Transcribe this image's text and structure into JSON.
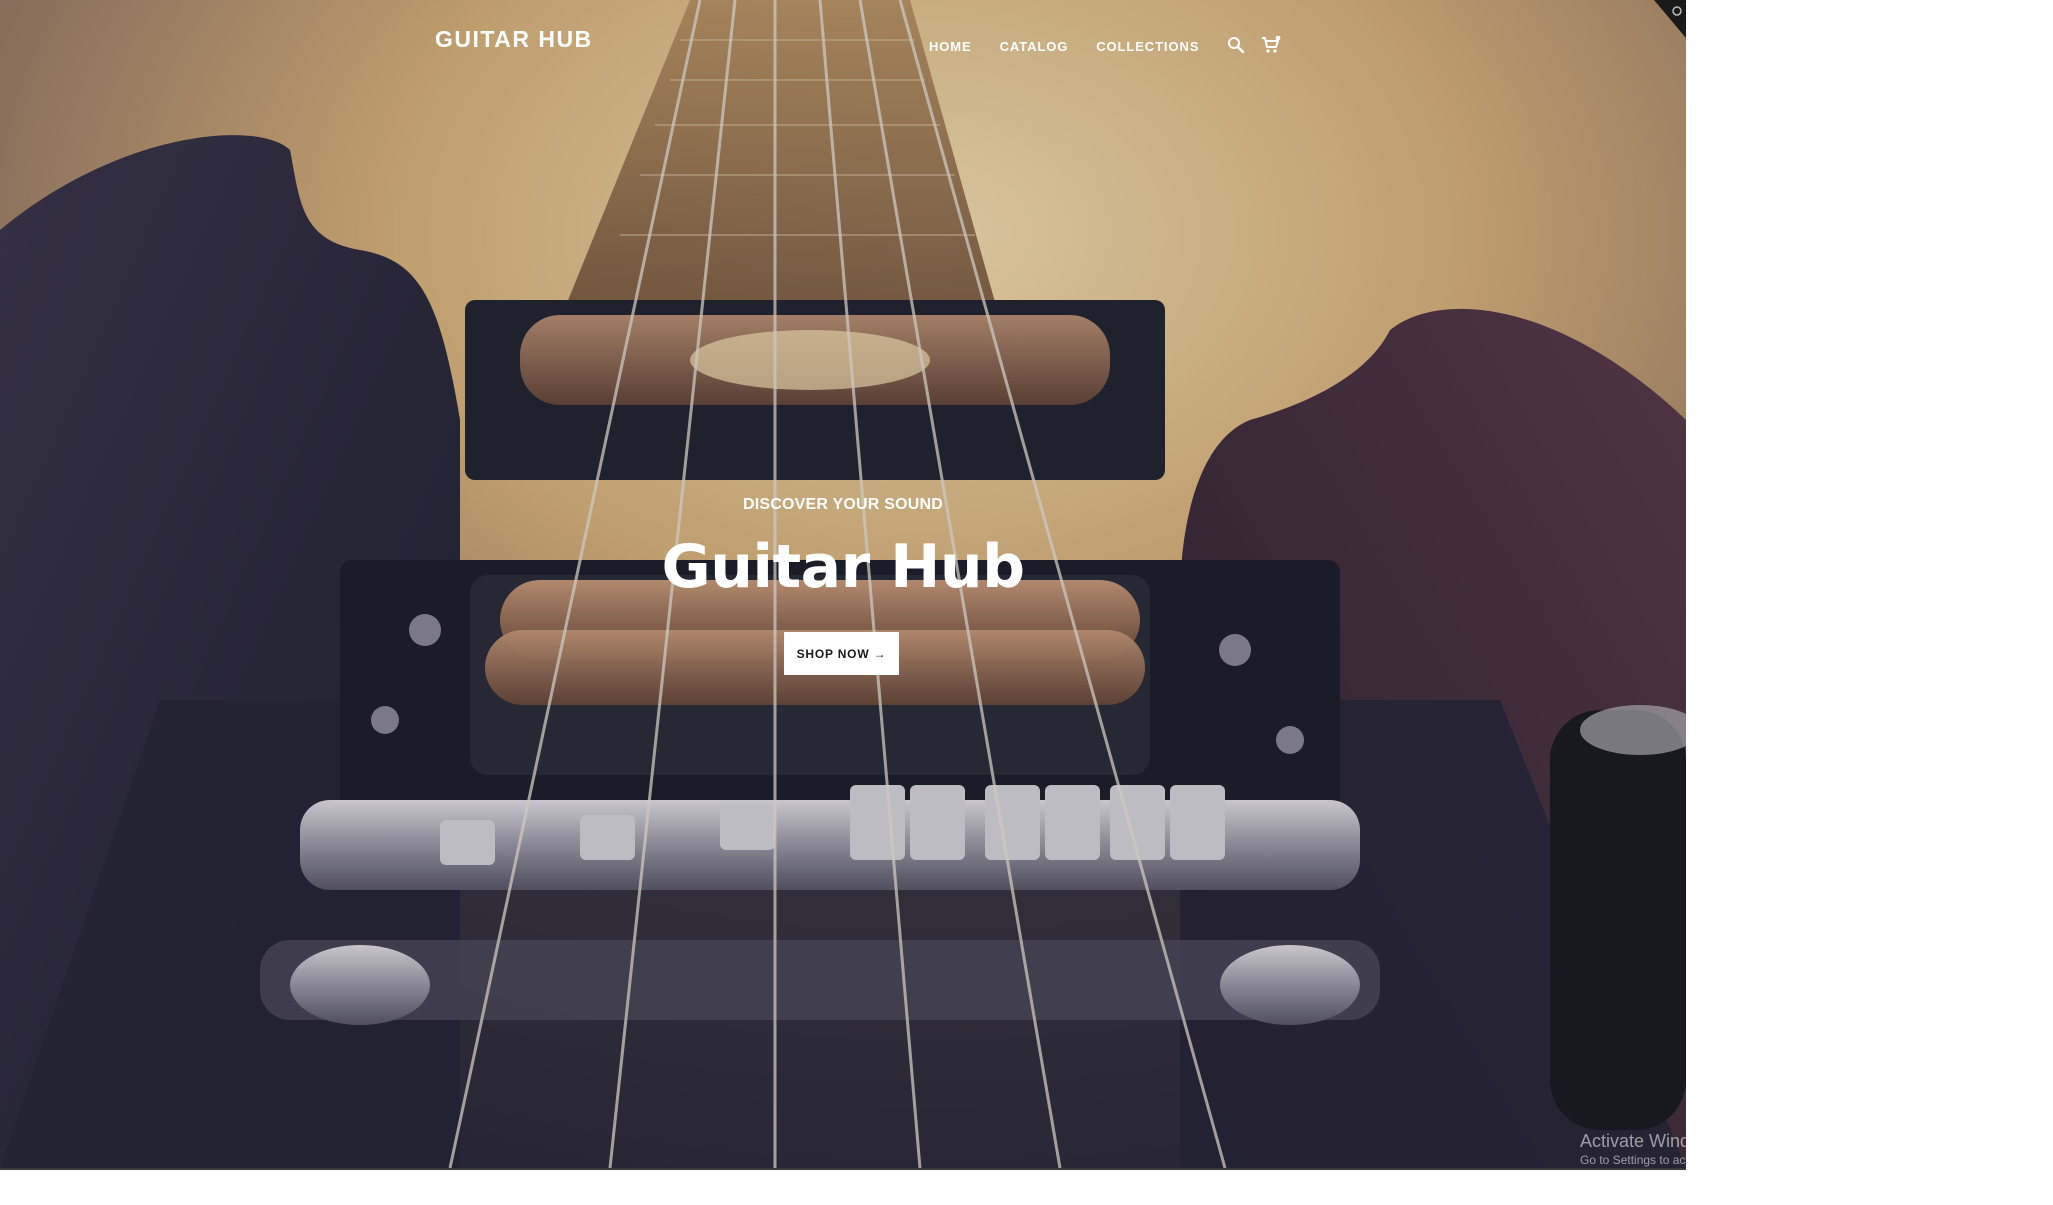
{
  "header": {
    "logo": "GUITAR HUB",
    "nav": [
      {
        "label": "HOME"
      },
      {
        "label": "CATALOG"
      },
      {
        "label": "COLLECTIONS"
      }
    ],
    "icons": [
      "search-icon",
      "cart-icon"
    ]
  },
  "hero": {
    "kicker": "DISCOVER YOUR SOUND",
    "title": "Guitar Hub",
    "cta_label": "SHOP NOW →"
  },
  "watermark": {
    "title": "Activate Windows",
    "subtitle": "Go to Settings to activate Windows."
  },
  "colors": {
    "text": "#ffffff",
    "button_bg": "#ffffff",
    "button_text": "#1a1a1a"
  }
}
